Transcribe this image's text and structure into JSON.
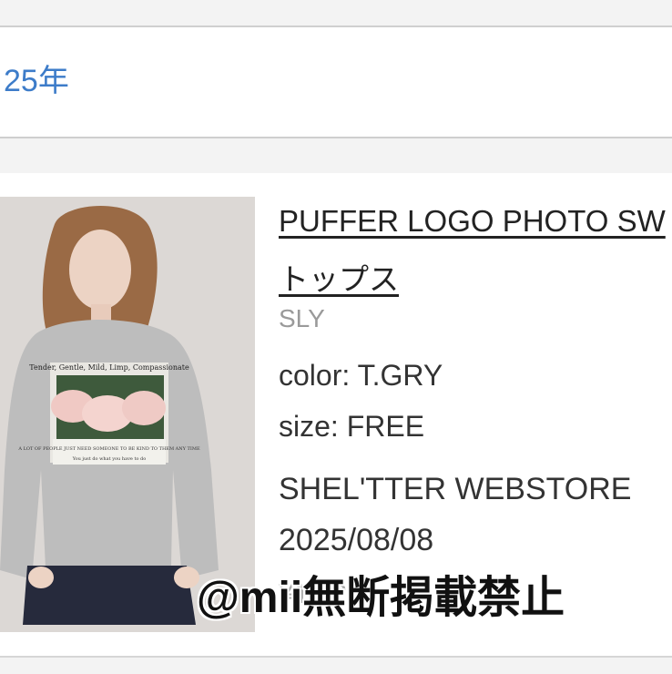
{
  "header": {
    "year_label": "25年"
  },
  "product": {
    "title": "PUFFER LOGO PHOTO SW",
    "category": "トップス",
    "brand": "SLY",
    "color": "color: T.GRY",
    "size": "size: FREE",
    "store": "SHEL'TTER WEBSTORE",
    "date": "2025/08/08",
    "price_partial": "¥13,2",
    "image": {
      "print_text_top": "Tender, Gentle, Mild, Limp, Compassionate",
      "print_text_middle": "A LOT OF PEOPLE JUST NEED SOMEONE TO BE KIND TO THEM ANY TIME",
      "print_text_bottom": "You just do what you have to do"
    }
  },
  "watermark": "@mii無断掲載禁止"
}
